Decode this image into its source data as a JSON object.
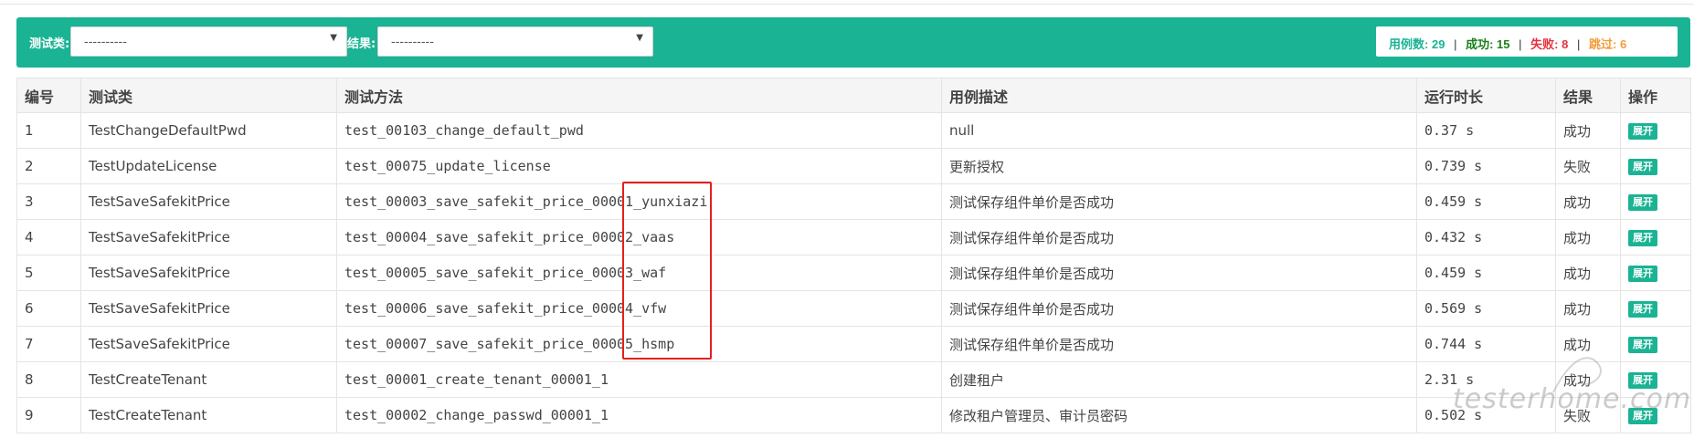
{
  "filters": {
    "test_class_label": "测试类:",
    "test_class_value": "----------",
    "result_label": "结果:",
    "result_value": "----------"
  },
  "summary": {
    "total_label": "用例数:",
    "total_value": "29",
    "pass_label": "成功:",
    "pass_value": "15",
    "fail_label": "失败:",
    "fail_value": "8",
    "skip_label": "跳过:",
    "skip_value": "6",
    "separator": "|"
  },
  "table": {
    "headers": [
      "编号",
      "测试类",
      "测试方法",
      "用例描述",
      "运行时长",
      "结果",
      "操作"
    ],
    "rows": [
      {
        "id": "1",
        "cls": "TestChangeDefaultPwd",
        "method": "test_00103_change_default_pwd",
        "desc": "null",
        "duration": "0.37 s",
        "result": "成功",
        "status": "pass",
        "action": "展开"
      },
      {
        "id": "2",
        "cls": "TestUpdateLicense",
        "method": "test_00075_update_license",
        "desc": "更新授权",
        "duration": "0.739 s",
        "result": "失败",
        "status": "fail",
        "action": "展开"
      },
      {
        "id": "3",
        "cls": "TestSaveSafekitPrice",
        "method": "test_00003_save_safekit_price_00001_yunxiazi",
        "desc": "测试保存组件单价是否成功",
        "duration": "0.459 s",
        "result": "成功",
        "status": "pass",
        "action": "展开"
      },
      {
        "id": "4",
        "cls": "TestSaveSafekitPrice",
        "method": "test_00004_save_safekit_price_00002_vaas",
        "desc": "测试保存组件单价是否成功",
        "duration": "0.432 s",
        "result": "成功",
        "status": "pass",
        "action": "展开"
      },
      {
        "id": "5",
        "cls": "TestSaveSafekitPrice",
        "method": "test_00005_save_safekit_price_00003_waf",
        "desc": "测试保存组件单价是否成功",
        "duration": "0.459 s",
        "result": "成功",
        "status": "pass",
        "action": "展开"
      },
      {
        "id": "6",
        "cls": "TestSaveSafekitPrice",
        "method": "test_00006_save_safekit_price_00004_vfw",
        "desc": "测试保存组件单价是否成功",
        "duration": "0.569 s",
        "result": "成功",
        "status": "pass",
        "action": "展开"
      },
      {
        "id": "7",
        "cls": "TestSaveSafekitPrice",
        "method": "test_00007_save_safekit_price_00005_hsmp",
        "desc": "测试保存组件单价是否成功",
        "duration": "0.744 s",
        "result": "成功",
        "status": "pass",
        "action": "展开"
      },
      {
        "id": "8",
        "cls": "TestCreateTenant",
        "method": "test_00001_create_tenant_00001_1",
        "desc": "创建租户",
        "duration": "2.31 s",
        "result": "成功",
        "status": "pass",
        "action": "展开"
      },
      {
        "id": "9",
        "cls": "TestCreateTenant",
        "method": "test_00002_change_passwd_00001_1",
        "desc": "修改租户管理员、审计员密码",
        "duration": "0.502 s",
        "result": "失败",
        "status": "fail",
        "action": "展开"
      }
    ]
  },
  "watermark": "testerhome.com",
  "colors": {
    "accent": "#1ab394",
    "fail": "#e5323e",
    "skip": "#f39c3a",
    "highlight": "#e3201b"
  }
}
